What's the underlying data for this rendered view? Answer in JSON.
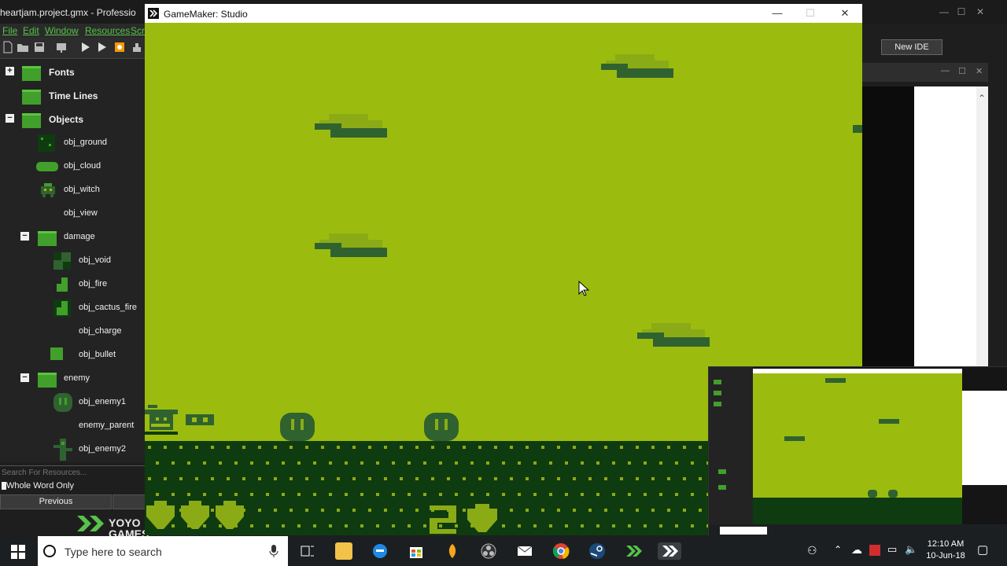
{
  "ide": {
    "title": "heartjam.project.gmx  -  Professio",
    "menu": [
      "File",
      "Edit",
      "Window",
      "Resources",
      "Scr"
    ],
    "new_ide_label": "New IDE"
  },
  "tree": {
    "items": [
      {
        "label": "Fonts",
        "kind": "folder",
        "expander": "+"
      },
      {
        "label": "Time Lines",
        "kind": "folder"
      },
      {
        "label": "Objects",
        "kind": "folder-open",
        "expander": "−"
      },
      {
        "label": "obj_ground"
      },
      {
        "label": "obj_cloud"
      },
      {
        "label": "obj_witch"
      },
      {
        "label": "obj_view"
      },
      {
        "label": "damage",
        "kind": "folder-open",
        "expander": "−"
      },
      {
        "label": "obj_void"
      },
      {
        "label": "obj_fire"
      },
      {
        "label": "obj_cactus_fire"
      },
      {
        "label": "obj_charge"
      },
      {
        "label": "obj_bullet"
      },
      {
        "label": "enemy",
        "kind": "folder-open",
        "expander": "−"
      },
      {
        "label": "obj_enemy1"
      },
      {
        "label": "enemy_parent"
      },
      {
        "label": "obj_enemy2"
      }
    ]
  },
  "search": {
    "placeholder": "Search For Resources...",
    "whole_word": "Whole Word Only",
    "previous": "Previous",
    "logo": "YOYO GAMES"
  },
  "game_window": {
    "title": "GameMaker: Studio",
    "minimize": "—",
    "maximize": "☐",
    "close": "✕"
  },
  "taskbar": {
    "search_placeholder": "Type here to search",
    "time": "12:10 AM",
    "date": "10-Jun-18"
  },
  "colors": {
    "gb_light": "#9bbc0f",
    "gb_mid": "#306230",
    "gb_dark": "#0f380f",
    "gb_mid_light": "#8bac0f",
    "ide_accent": "#41a02b"
  }
}
